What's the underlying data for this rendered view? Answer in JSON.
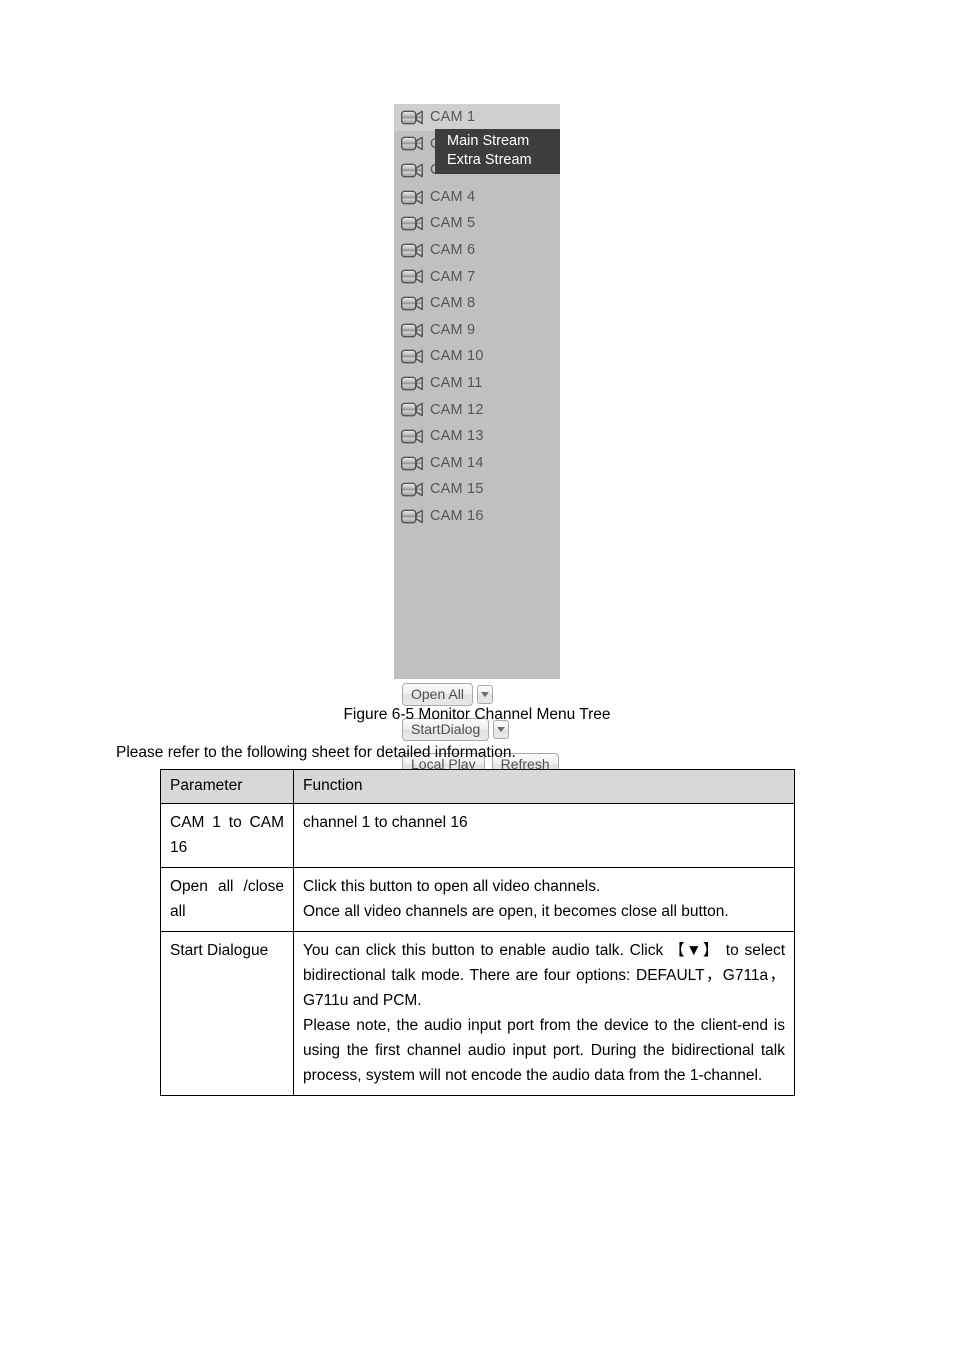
{
  "figure": {
    "caption": "Figure 6-5 Monitor Channel Menu Tree",
    "panel": {
      "channels": [
        {
          "icon": "camcorder-icon",
          "label": "CAM 1",
          "selected": true
        },
        {
          "icon": "camcorder-icon",
          "label": "CAM 2",
          "selected": false
        },
        {
          "icon": "camcorder-icon",
          "label": "CAM 3",
          "selected": false
        },
        {
          "icon": "camcorder-icon",
          "label": "CAM 4",
          "selected": false
        },
        {
          "icon": "camcorder-icon",
          "label": "CAM 5",
          "selected": false
        },
        {
          "icon": "camcorder-icon",
          "label": "CAM 6",
          "selected": false
        },
        {
          "icon": "camcorder-icon",
          "label": "CAM 7",
          "selected": false
        },
        {
          "icon": "camcorder-icon",
          "label": "CAM 8",
          "selected": false
        },
        {
          "icon": "camcorder-icon",
          "label": "CAM 9",
          "selected": false
        },
        {
          "icon": "camcorder-icon",
          "label": "CAM 10",
          "selected": false
        },
        {
          "icon": "camcorder-icon",
          "label": "CAM 11",
          "selected": false
        },
        {
          "icon": "camcorder-icon",
          "label": "CAM 12",
          "selected": false
        },
        {
          "icon": "camcorder-icon",
          "label": "CAM 13",
          "selected": false
        },
        {
          "icon": "camcorder-icon",
          "label": "CAM 14",
          "selected": false
        },
        {
          "icon": "camcorder-icon",
          "label": "CAM 15",
          "selected": false
        },
        {
          "icon": "camcorder-icon",
          "label": "CAM 16",
          "selected": false
        }
      ],
      "context_menu": {
        "items": [
          {
            "label": "Main Stream"
          },
          {
            "label": "Extra Stream"
          }
        ]
      },
      "buttons": {
        "open_all": "Open All",
        "start_dialog": "StartDialog",
        "local_play": "Local Play",
        "refresh": "Refresh"
      },
      "colors": {
        "panel_background": "#c0c0c0",
        "selected_row": "#cfcfcf",
        "context_menu_background": "#3d3d3d",
        "context_menu_text": "#ffffff",
        "channel_label_text": "#555555"
      }
    }
  },
  "body_text": {
    "intro": "Please refer to the following sheet for detailed information."
  },
  "table": {
    "headers": [
      "Parameter",
      "Function"
    ],
    "rows": [
      {
        "parameter": "CAM 1 to CAM 16",
        "function_lines": [
          "channel 1 to channel 16"
        ]
      },
      {
        "parameter": "Open all /close all",
        "function_lines": [
          "Click this button to open all video channels.",
          "Once all video channels are open, it becomes close all button."
        ]
      },
      {
        "parameter": "Start Dialogue",
        "function_lines": [
          "You can click this button to enable audio talk. Click 【▼】 to select bidirectional talk mode. There are four options: DEFAULT，G711a，G711u and PCM.",
          "Please note, the audio input port from the device to the client-end is using the first channel audio input port. During the bidirectional talk process, system will not encode the audio data from the 1-channel."
        ]
      }
    ]
  }
}
